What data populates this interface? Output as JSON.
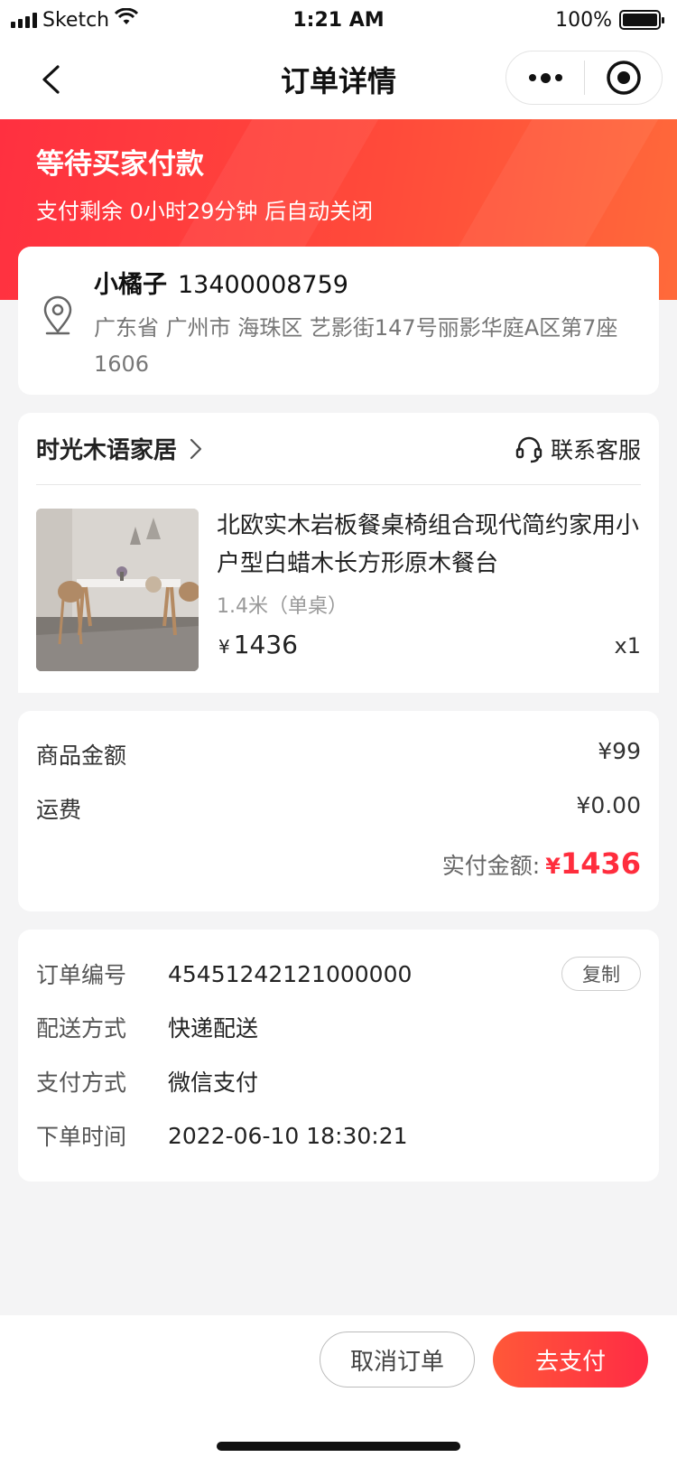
{
  "status_bar": {
    "carrier": "Sketch",
    "time": "1:21 AM",
    "battery_percent": "100%",
    "battery_level": 1.0
  },
  "nav": {
    "title": "订单详情"
  },
  "header": {
    "status_title": "等待买家付款",
    "countdown_text": "支付剩余 0小时29分钟 后自动关闭"
  },
  "address": {
    "name": "小橘子",
    "phone": "13400008759",
    "detail": "广东省 广州市 海珠区 艺影街147号丽影华庭A区第7座1606"
  },
  "shop": {
    "name": "时光木语家居",
    "service_label": "联系客服"
  },
  "product": {
    "title": "北欧实木岩板餐桌椅组合现代简约家用小户型白蜡木长方形原木餐台",
    "spec": "1.4米（单桌）",
    "currency": "¥",
    "price": "1436",
    "quantity": "x1"
  },
  "amounts": {
    "goods_label": "商品金额",
    "goods_value": "¥99",
    "shipping_label": "运费",
    "shipping_value": "¥0.00",
    "paid_label": "实付金额:",
    "paid_currency": "¥",
    "paid_value": "1436"
  },
  "order_info": {
    "number_label": "订单编号",
    "number_value": "45451242121000000",
    "copy_label": "复制",
    "delivery_label": "配送方式",
    "delivery_value": "快递配送",
    "payment_label": "支付方式",
    "payment_value": "微信支付",
    "time_label": "下单时间",
    "time_value": "2022-06-10 18:30:21"
  },
  "footer": {
    "cancel_label": "取消订单",
    "pay_label": "去支付"
  },
  "colors": {
    "accent": "#ff2d3d",
    "header_gradient_start": "#ff3040",
    "header_gradient_end": "#ff6a3a"
  }
}
